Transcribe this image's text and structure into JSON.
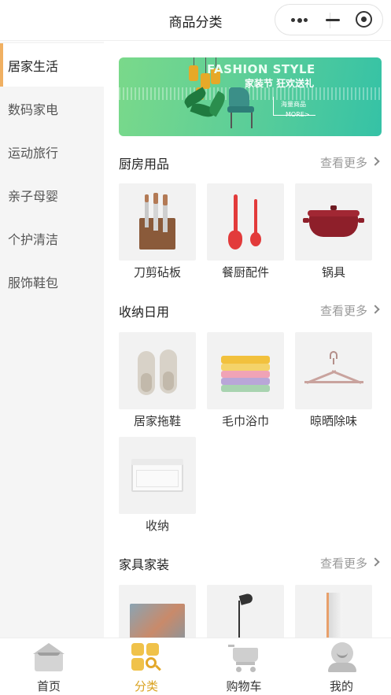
{
  "header": {
    "title": "商品分类"
  },
  "sidebar": {
    "items": [
      {
        "label": "居家生活",
        "active": true
      },
      {
        "label": "数码家电",
        "active": false
      },
      {
        "label": "运动旅行",
        "active": false
      },
      {
        "label": "亲子母婴",
        "active": false
      },
      {
        "label": "个护清洁",
        "active": false
      },
      {
        "label": "服饰鞋包",
        "active": false
      }
    ]
  },
  "banner": {
    "title": "FASHION STYLE",
    "subtitle": "家装节 狂欢送礼",
    "tag": "海量商品",
    "more": "MORE>"
  },
  "sections": [
    {
      "title": "厨房用品",
      "more": "查看更多",
      "items": [
        {
          "name": "刀剪砧板"
        },
        {
          "name": "餐厨配件"
        },
        {
          "name": "锅具"
        }
      ]
    },
    {
      "title": "收纳日用",
      "more": "查看更多",
      "items": [
        {
          "name": "居家拖鞋"
        },
        {
          "name": "毛巾浴巾"
        },
        {
          "name": "晾晒除味"
        },
        {
          "name": "收纳"
        }
      ]
    },
    {
      "title": "家具家装",
      "more": "查看更多",
      "items": [
        {
          "name": ""
        },
        {
          "name": ""
        },
        {
          "name": ""
        }
      ]
    }
  ],
  "tabbar": {
    "items": [
      {
        "label": "首页",
        "icon": "home-icon",
        "active": false
      },
      {
        "label": "分类",
        "icon": "category-icon",
        "active": true
      },
      {
        "label": "购物车",
        "icon": "cart-icon",
        "active": false
      },
      {
        "label": "我的",
        "icon": "profile-icon",
        "active": false
      }
    ]
  },
  "colors": {
    "accent": "#f0b062",
    "active_tab": "#d9a21f",
    "banner_start": "#7ad98a",
    "banner_end": "#35c2a6"
  }
}
